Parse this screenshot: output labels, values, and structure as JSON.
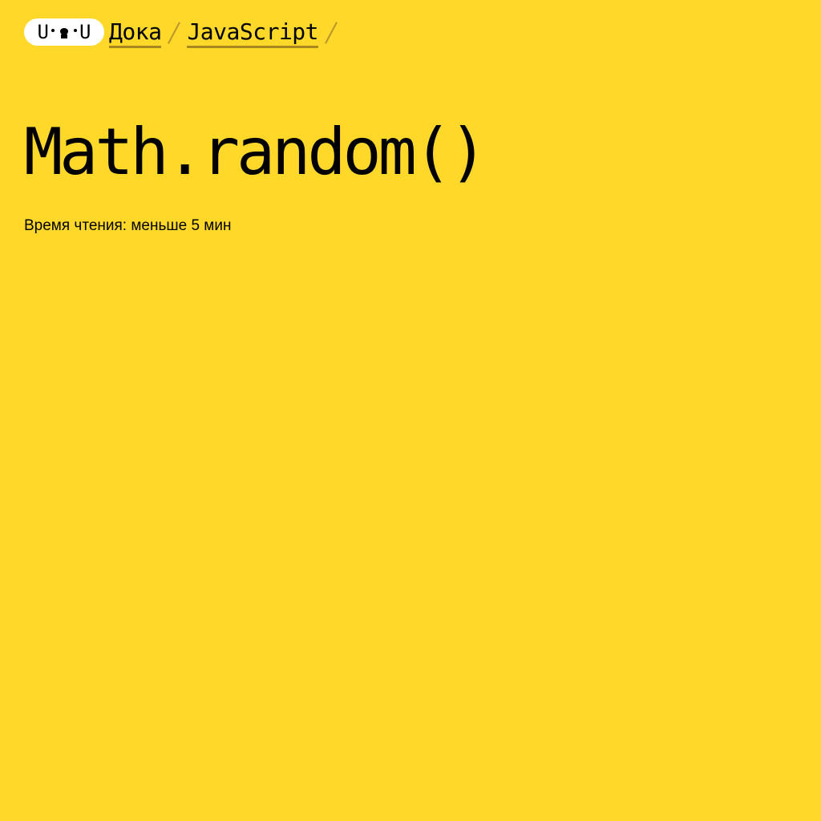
{
  "header": {
    "logo": {
      "left_char": "U",
      "right_char": "U",
      "icon": "doka-face-logo"
    },
    "breadcrumbs": [
      {
        "label": "Дока"
      },
      {
        "label": "JavaScript"
      }
    ],
    "separator_icon": "slash-separator"
  },
  "article": {
    "title": "Math.random()",
    "reading_time": "Время чтения: меньше 5 мин"
  },
  "colors": {
    "background": "#FFD82A",
    "link_underline": "#A8891E",
    "logo_background": "#FFFFFF"
  }
}
